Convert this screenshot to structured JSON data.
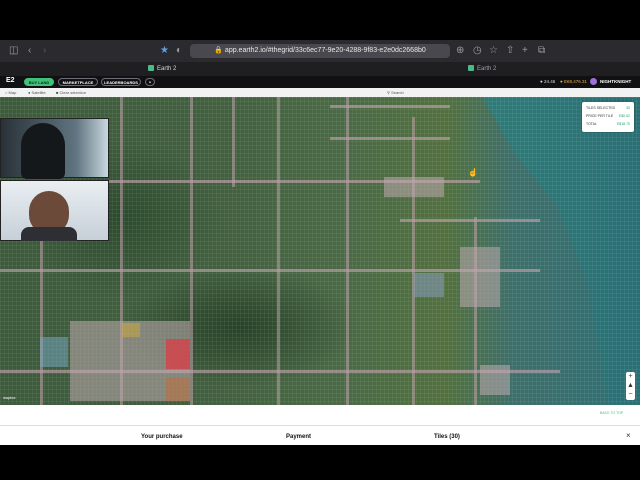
{
  "browser": {
    "url": "app.earth2.io/#thegrid/33c6ec77-9e20-4288-9f83-e2e0dc2668b0",
    "tabs": [
      {
        "label": "Earth 2"
      },
      {
        "label": "Earth 2"
      }
    ]
  },
  "app": {
    "logo": "E2",
    "nav": {
      "buy_land": "BUY LAND",
      "marketplace": "MARKETPLACE",
      "leaderboards": "LEADERBOARDS"
    },
    "balance": "24.46",
    "balance_secondary": "E€8,476.31",
    "username": "NIGHTKNIGHT",
    "accent_color": "#3fc17a"
  },
  "subbar": {
    "map_label": "Map",
    "satellite_label": "Satellite",
    "clear_selection": "Clear selection",
    "search_label": "Search"
  },
  "selection_panel": {
    "tiles_selected_label": "TILES SELECTED",
    "tiles_selected_value": "30",
    "price_per_tile_label": "PRICE PER TILE",
    "price_per_tile_value": "E$0.62",
    "total_label": "TOTAL",
    "total_value": "E$18.70"
  },
  "map": {
    "attribution": "mapbox",
    "zoom_in": "+",
    "zoom_out": "−",
    "back_to_top": "BACK TO TOP"
  },
  "checkout": {
    "your_purchase": "Your purchase",
    "payment": "Payment",
    "tiles": "Tiles (30)",
    "close": "×"
  }
}
